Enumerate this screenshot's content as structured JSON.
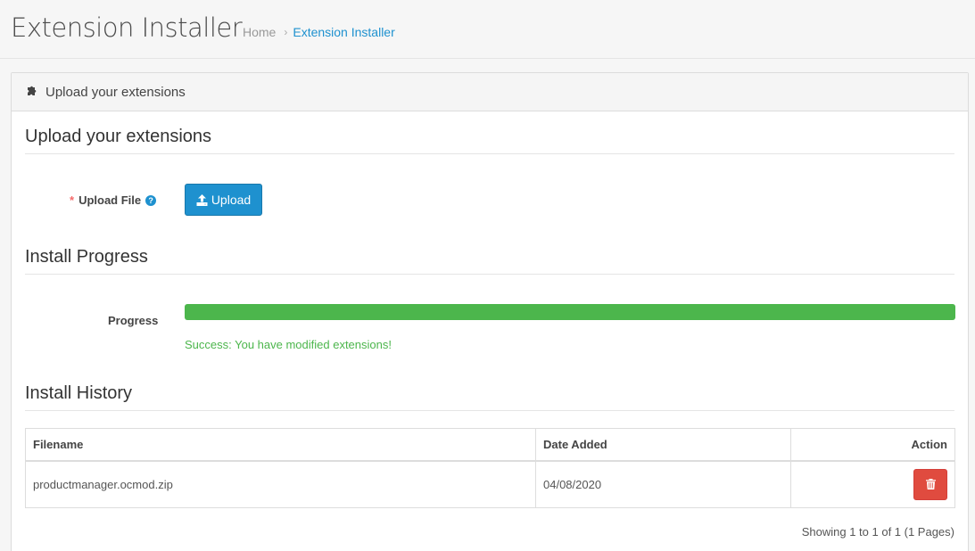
{
  "header": {
    "title": "Extension Installer",
    "breadcrumb": {
      "home": "Home",
      "separator": "›",
      "current": "Extension Installer"
    }
  },
  "panel": {
    "heading": "Upload your extensions",
    "heading_icon": "puzzle-icon"
  },
  "upload_section": {
    "legend": "Upload your extensions",
    "required_mark": "*",
    "label": "Upload File",
    "help_icon": "question-circle-icon",
    "help_glyph": "?",
    "button_label": "Upload",
    "button_icon": "upload-icon"
  },
  "progress_section": {
    "legend": "Install Progress",
    "label": "Progress",
    "value_percent": 100,
    "message": "Success: You have modified extensions!"
  },
  "history_section": {
    "legend": "Install History",
    "columns": [
      "Filename",
      "Date Added",
      "Action"
    ],
    "rows": [
      {
        "filename": "productmanager.ocmod.zip",
        "date_added": "04/08/2020",
        "action_icon": "trash-icon"
      }
    ],
    "pagination": "Showing 1 to 1 of 1 (1 Pages)"
  },
  "colors": {
    "primary": "#1e91cf",
    "success": "#4cb64c",
    "danger": "#e04b3f"
  }
}
